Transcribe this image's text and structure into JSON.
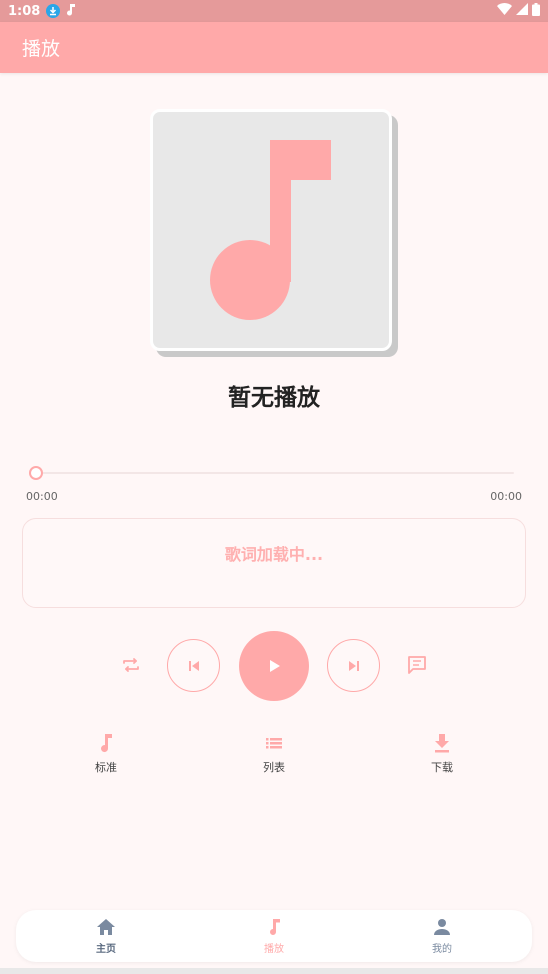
{
  "status_bar": {
    "time": "1:08",
    "icons": [
      "download-icon",
      "music-note-icon",
      "wifi-icon",
      "signal-icon",
      "battery-icon"
    ]
  },
  "app_bar": {
    "title": "播放"
  },
  "player": {
    "song_title": "暂无播放",
    "progress": 0,
    "current_time": "00:00",
    "total_time": "00:00",
    "lyrics_placeholder": "歌词加载中..."
  },
  "controls": [
    {
      "name": "repeat-icon"
    },
    {
      "name": "previous-icon"
    },
    {
      "name": "play-icon"
    },
    {
      "name": "next-icon"
    },
    {
      "name": "lyrics-icon"
    }
  ],
  "functions": [
    {
      "label": "标准",
      "icon": "music-note-icon"
    },
    {
      "label": "列表",
      "icon": "list-icon"
    },
    {
      "label": "下载",
      "icon": "download-icon"
    }
  ],
  "bottom_nav": [
    {
      "label": "主页",
      "icon": "home-icon",
      "active": false
    },
    {
      "label": "播放",
      "icon": "music-note-icon",
      "active": true
    },
    {
      "label": "我的",
      "icon": "person-icon",
      "active": false
    }
  ],
  "colors": {
    "accent": "#ffa9a9",
    "status_bar": "#e59a9a",
    "background": "#fff7f7",
    "nav_inactive": "#7a8aa0"
  }
}
